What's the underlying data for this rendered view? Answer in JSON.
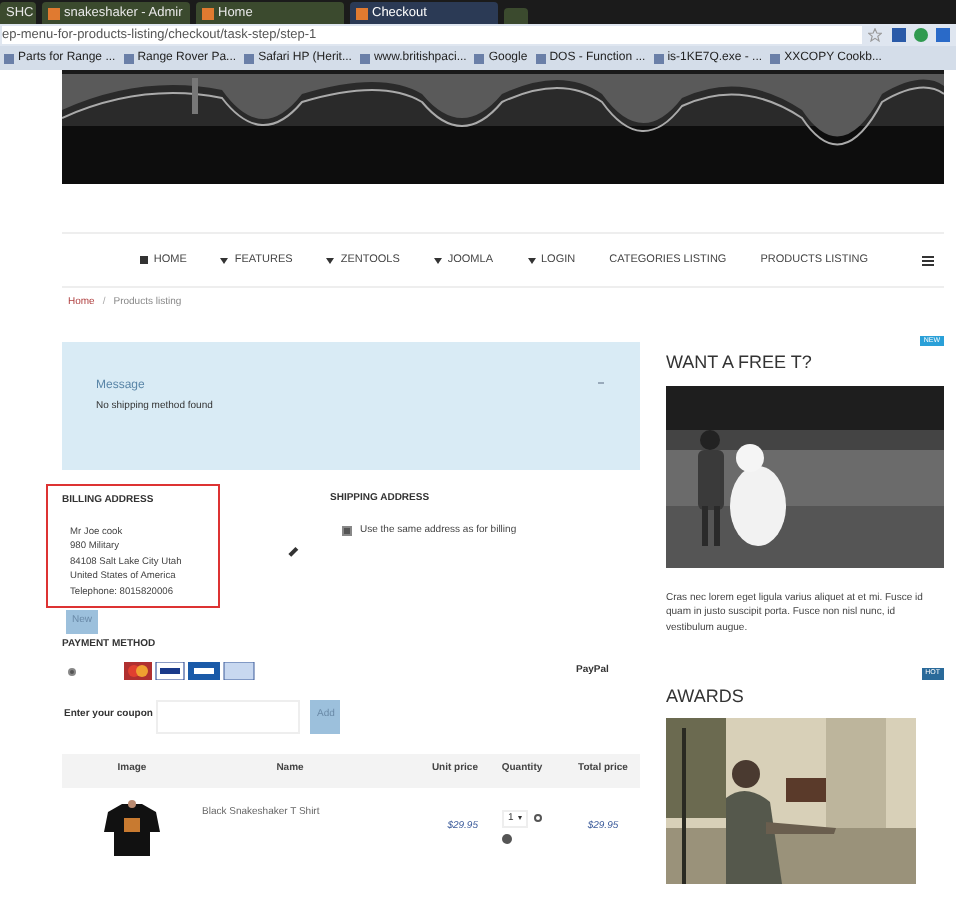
{
  "browser": {
    "tabs": [
      {
        "label": "SHC",
        "selected": false
      },
      {
        "label": "snakeshaker - Admir",
        "selected": false
      },
      {
        "label": "Home",
        "selected": false
      },
      {
        "label": "Checkout",
        "selected": true
      }
    ],
    "url": "ep-menu-for-products-listing/checkout/task-step/step-1",
    "bookmarks": [
      "Parts for Range ...",
      "Range Rover Pa...",
      "Safari HP (Herit...",
      "www.britishpaci...",
      "Google",
      "DOS - Function ...",
      "is-1KE7Q.exe - ...",
      "XXCOPY Cookb..."
    ]
  },
  "nav": [
    {
      "label": "HOME",
      "kind": "home"
    },
    {
      "label": "FEATURES",
      "kind": "dropdown"
    },
    {
      "label": "ZENTOOLS",
      "kind": "dropdown"
    },
    {
      "label": "JOOMLA",
      "kind": "dropdown"
    },
    {
      "label": "LOGIN",
      "kind": "dropdown"
    },
    {
      "label": "CATEGORIES LISTING",
      "kind": "plain"
    },
    {
      "label": "PRODUCTS LISTING",
      "kind": "plain"
    }
  ],
  "breadcrumb": {
    "items": [
      "Home",
      "Products listing"
    ],
    "separator": "/"
  },
  "message": {
    "title": "Message",
    "text": "No shipping method found"
  },
  "billing": {
    "title": "BILLING ADDRESS",
    "lines": [
      "Mr Joe cook",
      "980 Military",
      "84108 Salt Lake City Utah",
      "United States of America",
      "Telephone: 8015820006"
    ],
    "button": "New"
  },
  "shipping": {
    "title": "SHIPPING ADDRESS",
    "same_as_billing": {
      "label": "Use the same address as for billing",
      "checked": true
    }
  },
  "payment": {
    "title": "PAYMENT METHOD",
    "methods": [
      {
        "label": "PayPal",
        "selected": true
      }
    ]
  },
  "coupon": {
    "label": "Enter your coupon",
    "button": "Add"
  },
  "cart": {
    "columns": [
      "Image",
      "Name",
      "Unit price",
      "Quantity",
      "Total price"
    ],
    "rows": [
      {
        "name": "Black Snakeshaker T Shirt",
        "unit_price": "$29.95",
        "quantity": "1",
        "total": "$29.95"
      }
    ]
  },
  "sidebar": [
    {
      "badge": "NEW",
      "title": "WANT A FREE T?",
      "text": "Cras nec lorem eget ligula varius aliquet at et mi. Fusce id quam in justo suscipit porta. Fusce non nisl nunc, id vestibulum augue."
    },
    {
      "badge": "HOT",
      "title": "AWARDS"
    }
  ]
}
